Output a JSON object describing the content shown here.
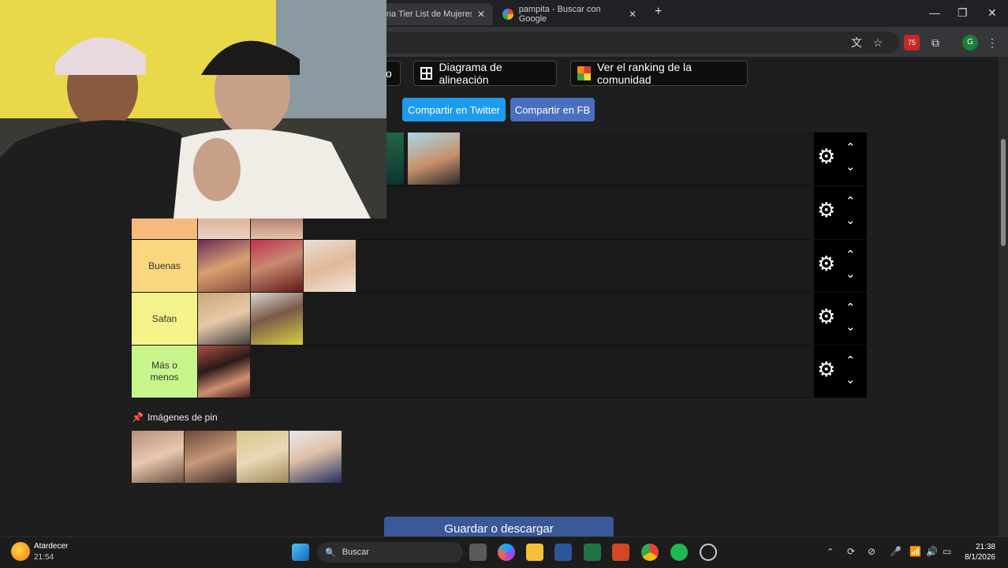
{
  "browser": {
    "tabs": [
      {
        "label": "na Tier List de Mujeres ..."
      },
      {
        "label": "pampita - Buscar con Google"
      }
    ],
    "new_tab": "+",
    "extension_badge": "75",
    "profile_initial": "G"
  },
  "page": {
    "buttons": {
      "partial_button_suffix": "o",
      "alignment_chart": "Diagrama de alineación",
      "community_ranking": "Ver el ranking de la comunidad",
      "share_twitter": "Compartir en Twitter",
      "share_fb": "Compartir en FB",
      "save_download": "Guardar o descargar"
    },
    "tiers": [
      {
        "label": "",
        "color": "#f5a571"
      },
      {
        "label": "",
        "color": "#f7b97c"
      },
      {
        "label": "",
        "color": "#f7c88a"
      },
      {
        "label": "Buenas",
        "color": "#f9d77f"
      },
      {
        "label": "Safan",
        "color": "#f5f48a"
      },
      {
        "label": "Más o menos",
        "color": "#c7f58c"
      }
    ],
    "pin_section": {
      "title": "Imágenes de pin"
    }
  },
  "taskbar": {
    "weather_label": "Atardecer",
    "weather_time": "21:54",
    "search_placeholder": "Buscar",
    "clock_time": "21:38",
    "clock_date": "8/1/2026"
  },
  "colors": {
    "twitter_blue": "#1d9bf0",
    "fb_blue": "#4267b2",
    "save_button": "#3b5998"
  }
}
